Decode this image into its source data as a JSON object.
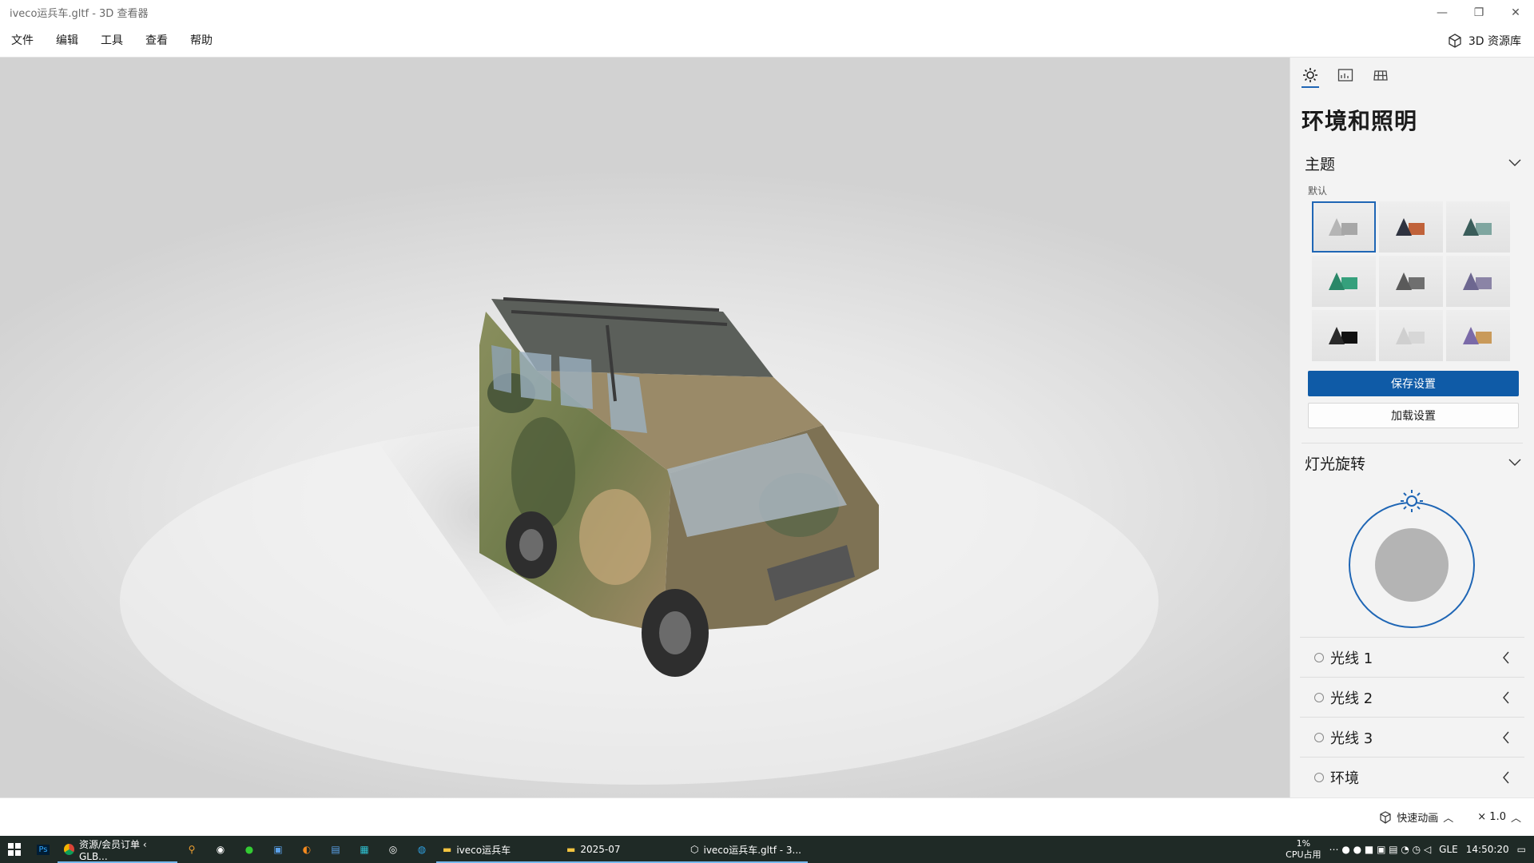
{
  "window": {
    "title": "iveco运兵车.gltf - 3D 查看器"
  },
  "menu": {
    "items": [
      "文件",
      "编辑",
      "工具",
      "查看",
      "帮助"
    ],
    "library_label": "3D 资源库"
  },
  "panel": {
    "title": "环境和照明",
    "theme": {
      "heading": "主题",
      "default_label": "默认",
      "selected_index": 0
    },
    "save_label": "保存设置",
    "load_label": "加载设置",
    "rotation": {
      "heading": "灯光旋转"
    },
    "lights": [
      {
        "label": "光线 1"
      },
      {
        "label": "光线 2"
      },
      {
        "label": "光线 3"
      },
      {
        "label": "环境"
      }
    ]
  },
  "status": {
    "animation_label": "快速动画",
    "speed": "× 1.0"
  },
  "taskbar": {
    "apps": [
      {
        "label": "资源/会员订单 ‹ GLB..."
      },
      {
        "label": "iveco运兵车"
      },
      {
        "label": "2025-07"
      },
      {
        "label": "iveco运兵车.gltf - 3..."
      }
    ],
    "cpu_value": "1%",
    "cpu_label": "CPU占用",
    "ime": "GLE",
    "time": "14:50:20"
  },
  "colors": {
    "accent": "#0f5ba7",
    "taskbar": "#1f2a26"
  }
}
